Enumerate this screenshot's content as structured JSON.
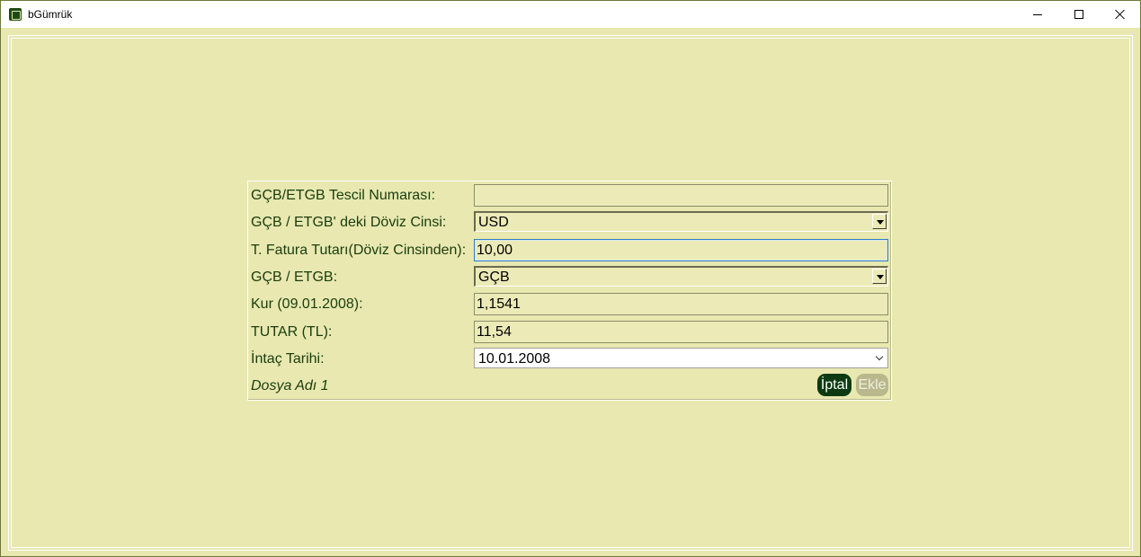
{
  "window": {
    "title": "bGümrük"
  },
  "form": {
    "rows": [
      {
        "label": "GÇB/ETGB Tescil Numarası:",
        "value": ""
      },
      {
        "label": "GÇB / ETGB' deki Döviz Cinsi:",
        "value": "USD"
      },
      {
        "label": "T. Fatura Tutarı(Döviz Cinsinden):",
        "value": "10,00"
      },
      {
        "label": "GÇB / ETGB:",
        "value": "GÇB"
      },
      {
        "label": "Kur (09.01.2008):",
        "value": "1,1541"
      },
      {
        "label": "TUTAR (TL):",
        "value": "11,54"
      },
      {
        "label": "İntaç Tarihi:",
        "value": "10.01.2008"
      }
    ],
    "footer": {
      "file_label": "Dosya Adı 1",
      "cancel_label": "İptal",
      "add_label": "Ekle"
    }
  },
  "colors": {
    "background": "#e8e8b0",
    "label_text": "#1a3d0e",
    "cancel_button": "#0d3a12",
    "add_button_disabled": "#b8b88c"
  }
}
